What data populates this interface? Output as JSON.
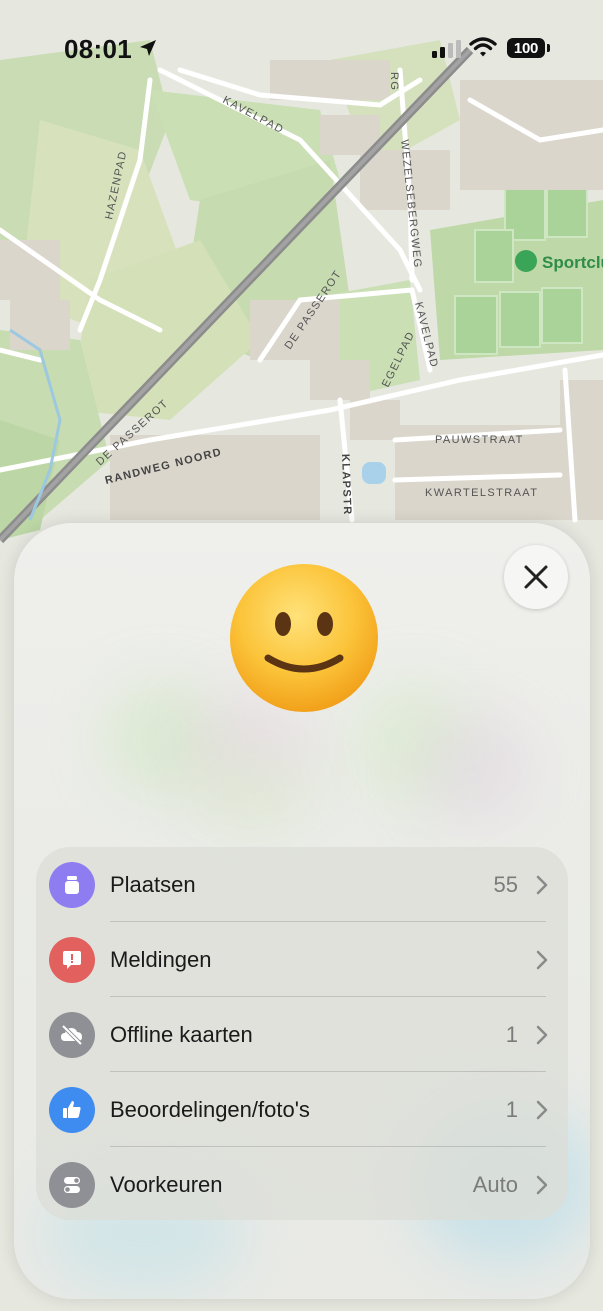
{
  "status_bar": {
    "time": "08:01",
    "battery": "100"
  },
  "map": {
    "labels": {
      "kavelpad_top": "KAVELPAD",
      "hazenpad": "HAZENPAD",
      "wezelsebergweg": "WEZELSEBERGWEG",
      "de_passerot_mid": "DE PASSEROT",
      "kavelpad_right": "KAVELPAD",
      "egelpad": "EGELPAD",
      "de_passerot_left": "DE PASSEROT",
      "randweg_noord": "RANDWEG NOORD",
      "klapstr": "KLAPSTR",
      "pauwstraat": "PAUWSTRAAT",
      "kwartelstraat": "KWARTELSTRAAT",
      "rg": "RG",
      "poi_sport": "Sportclu"
    }
  },
  "menu": {
    "items": [
      {
        "label": "Plaatsen",
        "value": "55",
        "icon": "square-stack-icon",
        "color": "#8e7df0"
      },
      {
        "label": "Meldingen",
        "value": "",
        "icon": "exclamation-bubble-icon",
        "color": "#e2615e"
      },
      {
        "label": "Offline kaarten",
        "value": "1",
        "icon": "cloud-slash-icon",
        "color": "#8f9096"
      },
      {
        "label": "Beoordelingen/foto's",
        "value": "1",
        "icon": "thumbs-up-icon",
        "color": "#3f8cf0"
      },
      {
        "label": "Voorkeuren",
        "value": "Auto",
        "icon": "toggles-icon",
        "color": "#8f9096"
      }
    ]
  }
}
